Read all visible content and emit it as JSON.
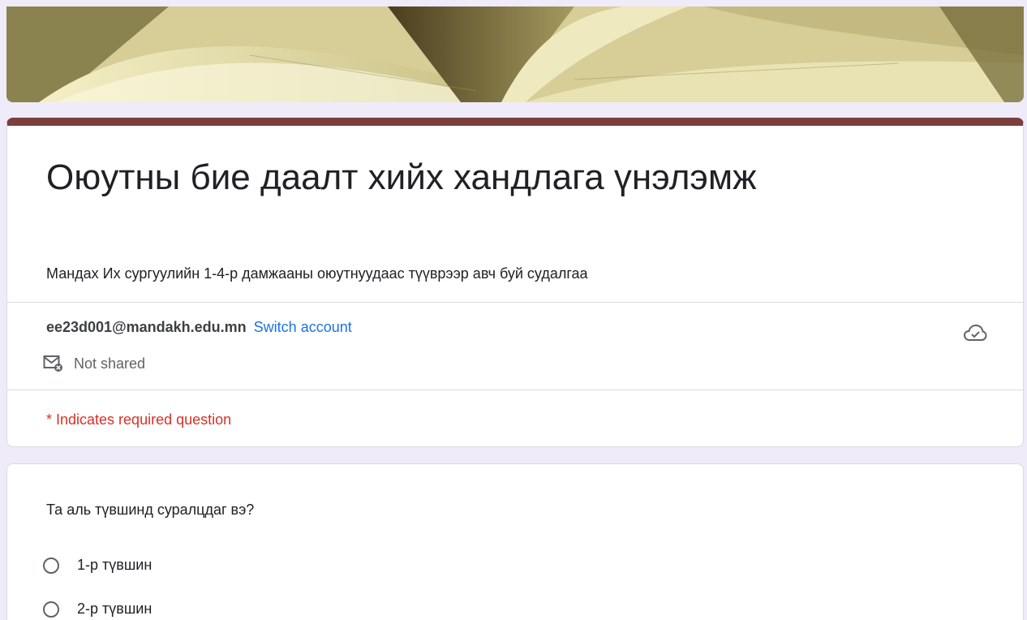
{
  "form": {
    "title": "Оюутны бие даалт хийх хандлага үнэлэмж",
    "description": "Мандах Их сургуулийн 1-4-р дамжааны оюутнуудаас түүврээр авч буй судалгаа",
    "theme_color": "#7b3f3f"
  },
  "account": {
    "email": "ee23d001@mandakh.edu.mn",
    "switch_label": "Switch account",
    "shared_status": "Not shared",
    "cloud_icon": "cloud-check-icon",
    "mail_icon": "mail-not-shared-icon"
  },
  "required_note": "* Indicates required question",
  "question": {
    "text": "Та аль түвшинд суралцдаг вэ?",
    "options": [
      {
        "label": "1-р түвшин"
      },
      {
        "label": "2-р түвшин"
      }
    ]
  }
}
